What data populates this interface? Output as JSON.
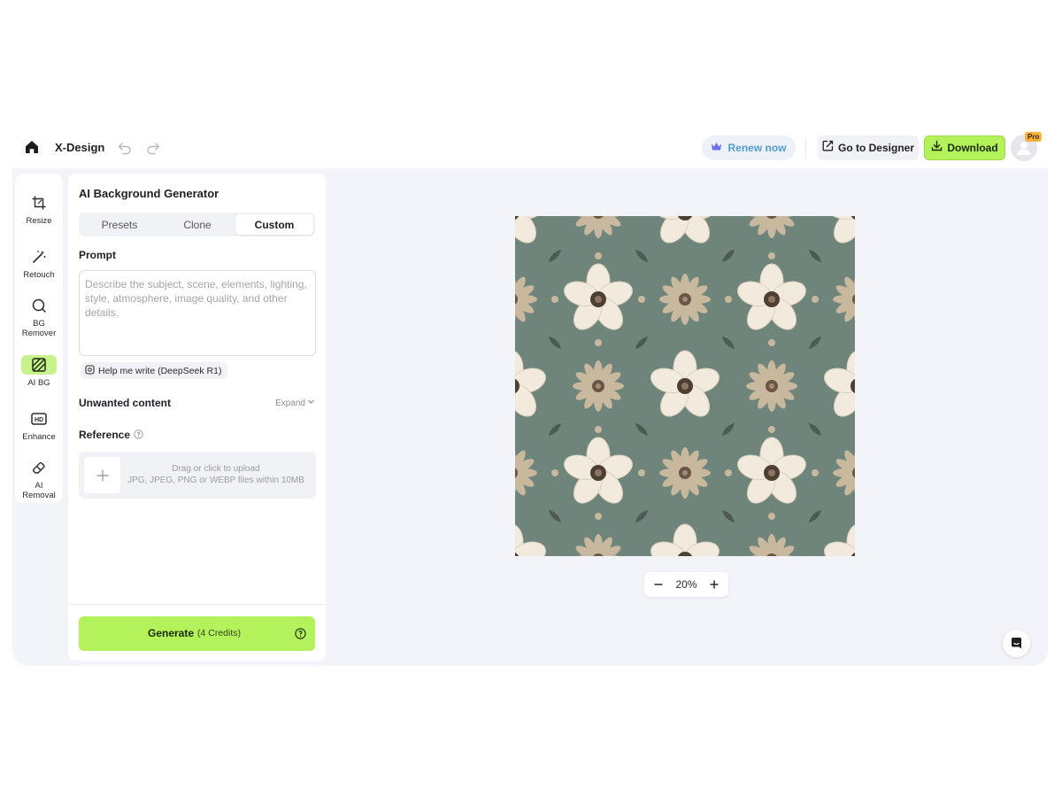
{
  "header": {
    "app_name": "X-Design",
    "renew_label": "Renew now",
    "designer_label": "Go to Designer",
    "download_label": "Download",
    "pro_badge": "Pro",
    "accent_color": "#b3f25a"
  },
  "toolrail": {
    "items": [
      {
        "label": "Resize",
        "icon": "crop-icon",
        "active": false
      },
      {
        "label": "Retouch",
        "icon": "magic-wand-icon",
        "active": false
      },
      {
        "label": "BG Remover",
        "icon": "bg-remover-icon",
        "active": false
      },
      {
        "label": "AI BG",
        "icon": "hatched-square-icon",
        "active": true
      },
      {
        "label": "Enhance",
        "icon": "hd-icon",
        "active": false
      },
      {
        "label": "AI Removal",
        "icon": "eraser-icon",
        "active": false
      }
    ]
  },
  "panel": {
    "title": "AI Background Generator",
    "tabs": [
      {
        "label": "Presets",
        "active": false
      },
      {
        "label": "Clone",
        "active": false
      },
      {
        "label": "Custom",
        "active": true
      }
    ],
    "prompt_label": "Prompt",
    "prompt_placeholder": "Describe the subject, scene, elements, lighting, style, atmosphere, image quality, and other details.",
    "prompt_value": "",
    "help_write_label": "Help me write (DeepSeek R1)",
    "unwanted_label": "Unwanted content",
    "expand_label": "Expand",
    "reference_label": "Reference",
    "upload_line1": "Drag or click to upload",
    "upload_line2": "JPG, JPEG, PNG or WEBP files within 10MB",
    "generate_label": "Generate",
    "generate_credits": "(4 Credits)"
  },
  "canvas": {
    "zoom": "20%",
    "pattern_colors": {
      "background": "#6f857c",
      "petal_light": "#f2ebdd",
      "petal_tan": "#c8b89d",
      "center_dark": "#4f3f33"
    }
  }
}
